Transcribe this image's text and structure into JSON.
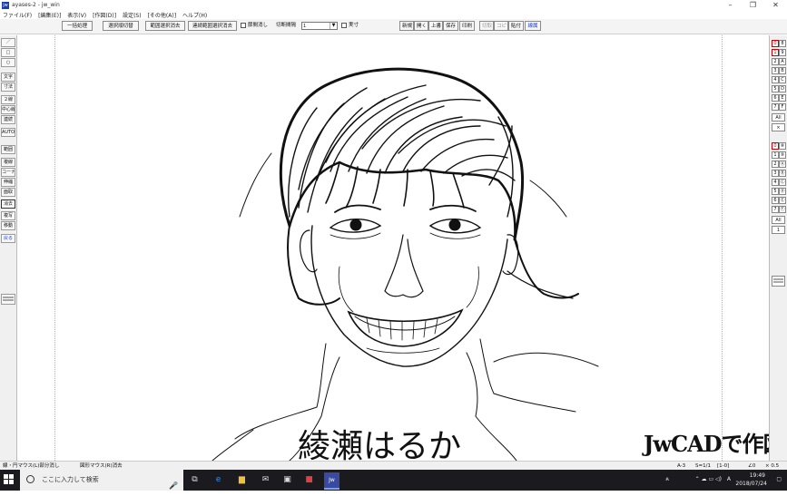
{
  "window": {
    "title": "ayases-2 - jw_win",
    "app_icon_text": "jw"
  },
  "menu": [
    "ファイル(F)",
    "[編集(E)]",
    "表示(V)",
    "[作図(D)]",
    "設定(S)",
    "[その他(A)]",
    "ヘルプ(H)"
  ],
  "toolbar": {
    "batch": "一括処理",
    "select_switch": "選択順切替",
    "range_delete": "範囲選択消去",
    "cont_range_delete": "連続範囲選択消去",
    "node_label": "節間消し",
    "cut_label": "切断間隔",
    "cut_value": "1",
    "actual_label": "実寸",
    "file_buttons": [
      "新規",
      "開く",
      "上書",
      "保存",
      "印刷",
      "切取",
      "コピー",
      "貼付",
      "線属"
    ]
  },
  "left_tools": [
    "／",
    "□",
    "○",
    "文字",
    "寸法",
    "２線",
    "中心線",
    "連続",
    "AUTO",
    "範囲",
    "複線",
    "コーナー",
    "伸縮",
    "面取",
    "消去",
    "複写",
    "移動",
    "戻る"
  ],
  "right_tools": {
    "group_a": [
      [
        "0",
        "8"
      ],
      [
        "1",
        "9"
      ],
      [
        "2",
        "A"
      ],
      [
        "3",
        "B"
      ],
      [
        "4",
        "C"
      ],
      [
        "5",
        "D"
      ],
      [
        "6",
        "E"
      ],
      [
        "7",
        "F"
      ]
    ],
    "all_a": "All",
    "x_a": "×",
    "group_b": [
      [
        "0",
        "⑧"
      ],
      [
        "1",
        "⑨"
      ],
      [
        "2",
        "Ⓐ"
      ],
      [
        "3",
        "Ⓑ"
      ],
      [
        "4",
        "Ⓒ"
      ],
      [
        "5",
        "Ⓓ"
      ],
      [
        "6",
        "Ⓔ"
      ],
      [
        "7",
        "Ⓕ"
      ]
    ],
    "all_b": "All",
    "one_b": "1"
  },
  "canvas": {
    "caption": "綾瀬はるか",
    "jw_caption": "JwCADで作図"
  },
  "status": {
    "left": "線・円マウス(L)部分消し",
    "mid": "図形マウス(R)消去",
    "scale_paper": "A-3",
    "scale": "S=1/1",
    "layer": "[1-0]",
    "angle": "∠0",
    "zoom": "× 0.5"
  },
  "taskbar": {
    "search_placeholder": "ここに入力して検索",
    "time": "19:49",
    "date": "2018/07/24",
    "ime": "A"
  },
  "colors": {
    "accent_red": "#cc0000",
    "taskbar_bg": "#1b1b1f",
    "guide": "#a0b4d8"
  }
}
